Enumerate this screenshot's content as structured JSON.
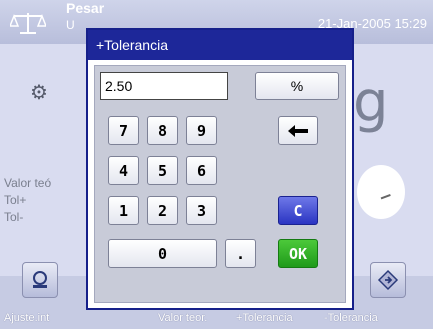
{
  "background": {
    "title": "Pesar",
    "subtitle": "U",
    "datetime": "21-Jan-2005 15:29",
    "unit_char": "g",
    "rows": [
      "Valor teó",
      "Tol+",
      "Tol-"
    ],
    "footer_labels": [
      "Ajuste.int",
      "Valor teor.",
      "+Tolerancia",
      "-Tolerancia"
    ]
  },
  "dialog": {
    "title": "+Tolerancia",
    "input_value": "2.50",
    "unit_button": "%",
    "keys": {
      "k7": "7",
      "k8": "8",
      "k9": "9",
      "k4": "4",
      "k5": "5",
      "k6": "6",
      "k1": "1",
      "k2": "2",
      "k3": "3",
      "k0": "0",
      "kdot": ".",
      "backspace": "←",
      "clear": "C",
      "ok": "OK"
    }
  },
  "colors": {
    "title_bar": "#1d2799",
    "clear_key": "#2a34c2",
    "ok_key": "#1f9a1a",
    "screen_bg": "#d9dcf0"
  }
}
